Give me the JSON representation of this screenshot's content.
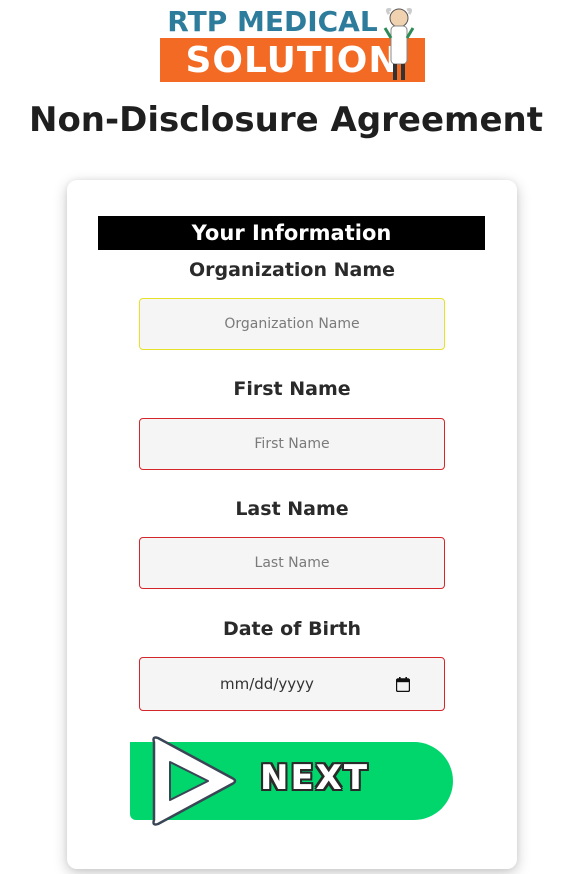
{
  "logo": {
    "top_text": "RTP MEDICAL",
    "bottom_text": "SOLUTION",
    "colors": {
      "top": "#2e7c9c",
      "bottom_bg": "#f26a24"
    }
  },
  "page": {
    "title": "Non-Disclosure Agreement"
  },
  "form": {
    "section_header": "Your Information",
    "fields": [
      {
        "label": "Organization Name",
        "placeholder": "Organization Name"
      },
      {
        "label": "First Name",
        "placeholder": "First Name"
      },
      {
        "label": "Last Name",
        "placeholder": "Last Name"
      },
      {
        "label": "Date of Birth",
        "placeholder": "mm/dd/yyyy"
      }
    ],
    "next_label": "NEXT"
  },
  "icons": {
    "calendar": "calendar-icon",
    "play": "play-icon",
    "mascot": "doctor-mascot-icon"
  },
  "colors": {
    "accent_green": "#00d66c",
    "error_border": "#d4262a",
    "focus_border": "#e6e22a"
  }
}
